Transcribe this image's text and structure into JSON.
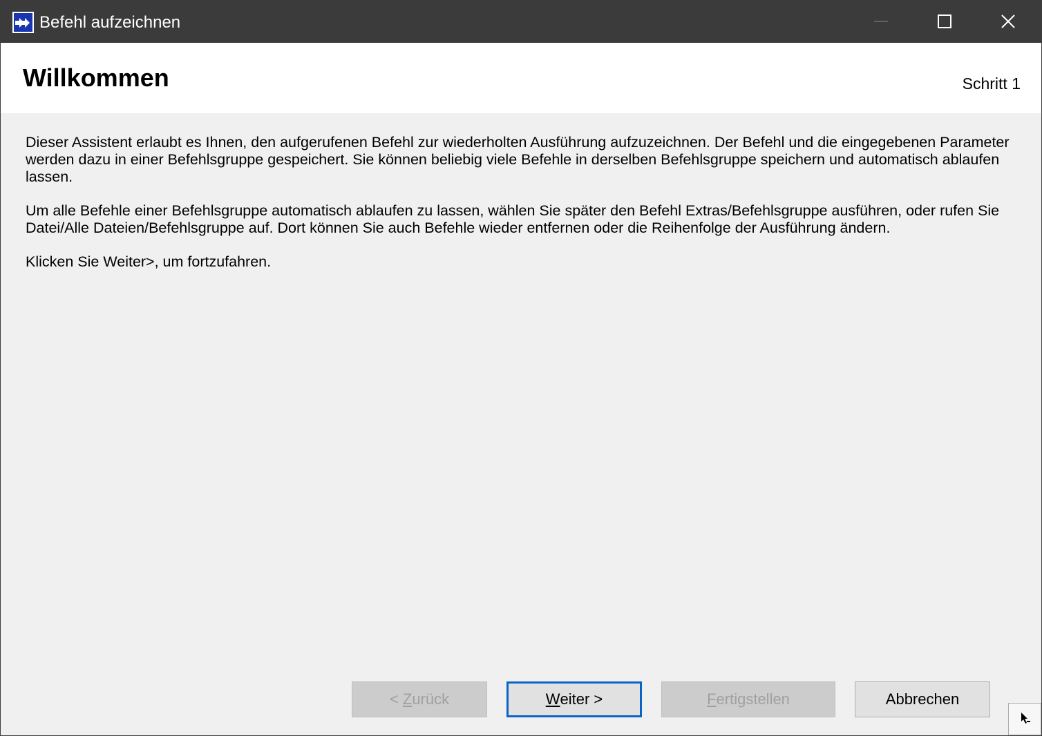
{
  "window": {
    "title": "Befehl aufzeichnen",
    "app_icon": "double-arrow-right-icon",
    "controls": [
      "minimize-icon",
      "maximize-icon",
      "close-icon"
    ]
  },
  "header": {
    "heading": "Willkommen",
    "step": "Schritt 1"
  },
  "content": {
    "paragraphs": [
      "Dieser Assistent erlaubt es Ihnen, den aufgerufenen Befehl zur wiederholten Ausführung aufzuzeichnen. Der Befehl und die eingegebenen Parameter werden dazu in einer Befehlsgruppe gespeichert. Sie können beliebig viele Befehle in derselben Befehlsgruppe speichern und automatisch ablaufen lassen.",
      "Um alle Befehle einer Befehlsgruppe automatisch ablaufen zu lassen, wählen Sie später den Befehl Extras/Befehlsgruppe ausführen, oder rufen Sie Datei/Alle Dateien/Befehlsgruppe auf. Dort können Sie auch Befehle wieder entfernen oder die Reihenfolge der Ausführung ändern.",
      "Klicken Sie Weiter>, um fortzufahren."
    ]
  },
  "buttons": {
    "back": {
      "prefix": "< ",
      "accel": "Z",
      "rest": "urück",
      "enabled": false
    },
    "next": {
      "prefix": "",
      "accel": "W",
      "rest": "eiter >",
      "enabled": true,
      "default": true
    },
    "finish": {
      "prefix": "",
      "accel": "F",
      "rest": "ertigstellen",
      "enabled": false
    },
    "cancel": {
      "label": "Abbrechen",
      "enabled": true
    }
  },
  "colors": {
    "titlebar": "#3b3b3b",
    "dialog_bg": "#f0f0f0",
    "header_bg": "#ffffff",
    "default_button_border": "#0a64c8",
    "app_icon_bg": "#1a35b0"
  },
  "icons": {
    "help_grip": "help-cursor-icon"
  }
}
